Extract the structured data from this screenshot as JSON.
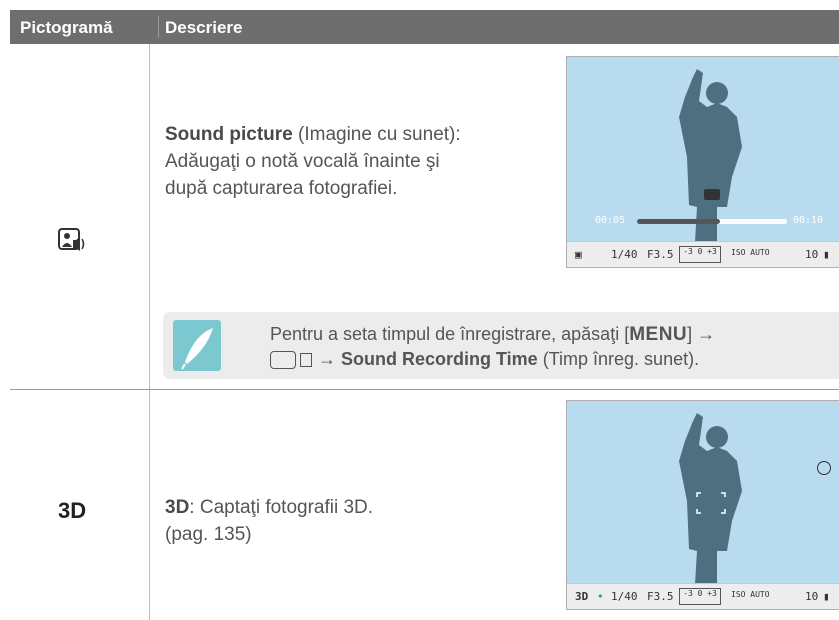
{
  "table": {
    "col_icon_header": "Pictogramă",
    "col_desc_header": "Descriere"
  },
  "rows": [
    {
      "icon": "sound-picture-icon",
      "title": "Sound picture",
      "title_suffix": " (Imagine cu sunet):",
      "line2": "Adăugaţi o notă vocală înainte şi",
      "line3": "după capturarea fotografiei.",
      "screen": {
        "time_start": "00:05",
        "time_end": "00:10",
        "progress": 0.55,
        "shutter": "1/40",
        "aperture": "F3.5",
        "iso": "ISO AUTO",
        "shots": "10"
      },
      "note": {
        "line1_prefix": "Pentru a seta timpul de înregistrare, apăsaţi [",
        "menu_key": "MENU",
        "line1_suffix": "] →",
        "line2_arrow": "→",
        "line2_bold": "Sound Recording Time",
        "line2_suffix": " (Timp înreg. sunet)."
      }
    },
    {
      "icon": "3d-icon",
      "icon_text": "3D",
      "title": "3D",
      "title_suffix": ": Captaţi fotografii 3D.",
      "line2": "(pag. 135)",
      "screen": {
        "shutter": "1/40",
        "aperture": "F3.5",
        "iso": "ISO AUTO",
        "shots": "10"
      }
    }
  ]
}
